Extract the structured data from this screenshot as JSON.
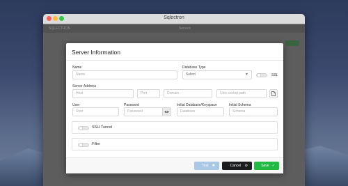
{
  "window": {
    "title": "Sqlectron"
  },
  "app_bar": {
    "brand": "SQLECTRON",
    "tab": "Servers"
  },
  "dialog": {
    "title": "Server Information",
    "name": {
      "label": "Name",
      "placeholder": "Name"
    },
    "database_type": {
      "label": "Database Type",
      "value": "Select"
    },
    "ssl": {
      "label": "SSL"
    },
    "server_address": {
      "label": "Server Address",
      "host_placeholder": "Host",
      "port_placeholder": "Port",
      "domain_placeholder": "Domain",
      "socket_placeholder": "Unix socket path"
    },
    "user": {
      "label": "User",
      "placeholder": "User"
    },
    "password": {
      "label": "Password",
      "placeholder": "Password"
    },
    "initial_database": {
      "label": "Initial Database/Keyspace",
      "placeholder": "Database"
    },
    "initial_schema": {
      "label": "Initial Schema",
      "placeholder": "Schema"
    },
    "ssh_tunnel": {
      "label": "SSH Tunnel"
    },
    "filter": {
      "label": "Filter"
    },
    "buttons": {
      "test": "Test",
      "cancel": "Cancel",
      "save": "Save"
    },
    "colors": {
      "test": "#a9c8e6",
      "cancel": "#1b1c1d",
      "save": "#21ba45"
    }
  }
}
